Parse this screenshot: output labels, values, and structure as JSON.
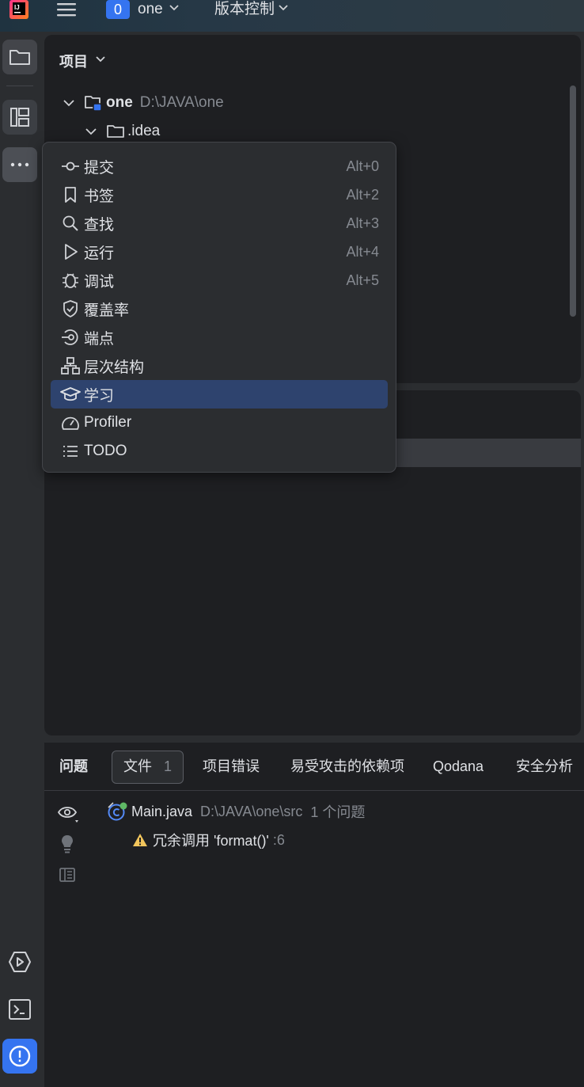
{
  "titlebar": {
    "app_logo_text": "IJ",
    "project_badge": "0",
    "project_name": "one",
    "vcs_label": "版本控制"
  },
  "project_panel": {
    "title": "项目",
    "tree": [
      {
        "name": "one",
        "path": "D:\\JAVA\\one"
      },
      {
        "name": ".idea",
        "path": ""
      }
    ]
  },
  "popup_menu": {
    "items": [
      {
        "label": "提交",
        "shortcut": "Alt+0",
        "icon": "commit-icon"
      },
      {
        "label": "书签",
        "shortcut": "Alt+2",
        "icon": "bookmark-icon"
      },
      {
        "label": "查找",
        "shortcut": "Alt+3",
        "icon": "search-icon"
      },
      {
        "label": "运行",
        "shortcut": "Alt+4",
        "icon": "run-icon"
      },
      {
        "label": "调试",
        "shortcut": "Alt+5",
        "icon": "debug-icon"
      },
      {
        "label": "覆盖率",
        "shortcut": "",
        "icon": "coverage-icon"
      },
      {
        "label": "端点",
        "shortcut": "",
        "icon": "endpoints-icon"
      },
      {
        "label": "层次结构",
        "shortcut": "",
        "icon": "hierarchy-icon"
      },
      {
        "label": "学习",
        "shortcut": "",
        "icon": "learn-icon",
        "selected": true
      },
      {
        "label": "Profiler",
        "shortcut": "",
        "icon": "profiler-icon"
      },
      {
        "label": "TODO",
        "shortcut": "",
        "icon": "todo-icon"
      }
    ]
  },
  "problems_panel": {
    "tabs": [
      {
        "label": "问题"
      },
      {
        "label": "文件",
        "count": "1"
      },
      {
        "label": "项目错误"
      },
      {
        "label": "易受攻击的依赖项"
      },
      {
        "label": "Qodana"
      },
      {
        "label": "安全分析"
      }
    ],
    "file": {
      "name": "Main.java",
      "path": "D:\\JAVA\\one\\src",
      "count": "1 个问题"
    },
    "problem": {
      "text": "冗余调用 'format()'",
      "line": ":6"
    }
  },
  "colors": {
    "accent": "#3574f0",
    "selection": "#2e436e",
    "warning": "#f2c55c",
    "panel_bg": "#1e1f22",
    "chrome_bg": "#2b2d30"
  }
}
